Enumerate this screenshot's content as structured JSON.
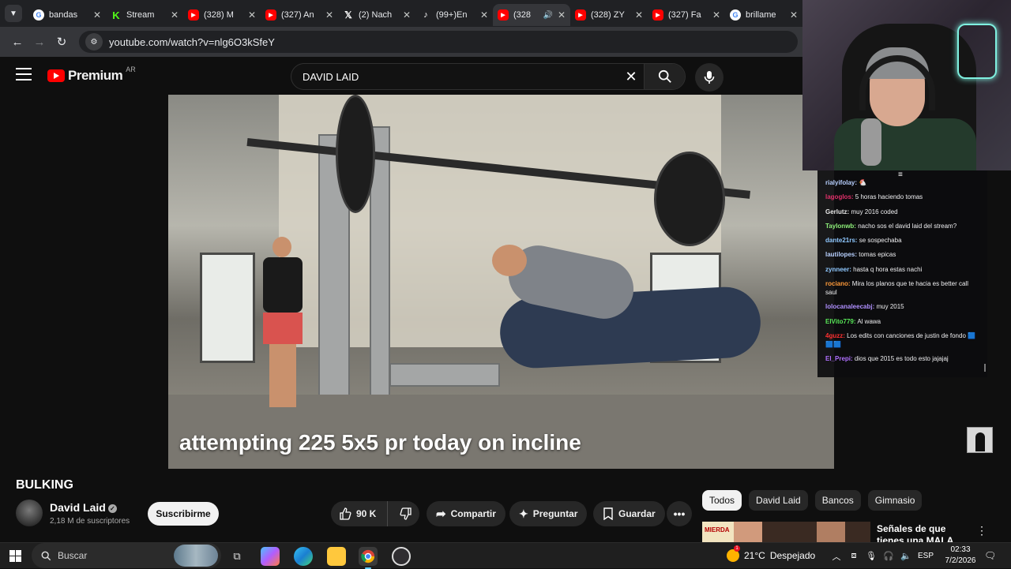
{
  "browser": {
    "tabs": [
      {
        "title": "bandas",
        "favicon": "google-icon"
      },
      {
        "title": "Stream",
        "favicon": "kick-icon"
      },
      {
        "title": "(328) M",
        "favicon": "youtube-icon"
      },
      {
        "title": "(327) An",
        "favicon": "youtube-icon"
      },
      {
        "title": "(2) Nach",
        "favicon": "x-icon"
      },
      {
        "title": "(99+)En",
        "favicon": "tiktok-icon"
      },
      {
        "title": "(328",
        "favicon": "youtube-icon",
        "active": true
      },
      {
        "title": "(328) ZY",
        "favicon": "youtube-icon"
      },
      {
        "title": "(327) Fa",
        "favicon": "youtube-icon"
      },
      {
        "title": "brillame",
        "favicon": "google-icon"
      }
    ],
    "url": "youtube.com/watch?v=nlg6O3kSfeY"
  },
  "youtube": {
    "brand": "Premium",
    "country": "AR",
    "search_query": "DAVID LAID"
  },
  "video": {
    "caption": "attempting 225 5x5 pr today on incline",
    "title": "BULKING",
    "channel": "David Laid",
    "subscribers": "2,18 M de suscriptores",
    "subscribe_label": "Suscribirme",
    "likes": "90 K",
    "share_label": "Compartir",
    "ask_label": "Preguntar",
    "save_label": "Guardar"
  },
  "chips": [
    "Todos",
    "David Laid",
    "Bancos",
    "Gimnasio"
  ],
  "recommended": {
    "badge": "MIERDA",
    "title": "Señales de que tienes una MALA GENÉTIC"
  },
  "chat": [
    {
      "user": "rialyifolay:",
      "text": "🐔",
      "color": "#b8d0ff"
    },
    {
      "user": "lagoglos:",
      "text": "5 horas haciendo tomas",
      "color": "#e0306a"
    },
    {
      "user": "Gerlutz:",
      "text": "muy 2016 coded",
      "color": "#e8e8e8"
    },
    {
      "user": "Taylonwb:",
      "text": "nacho sos el david laid del stream?",
      "color": "#8ef07a"
    },
    {
      "user": "dante21rs:",
      "text": "se sospechaba",
      "color": "#8fc8ff"
    },
    {
      "user": "lautilopes:",
      "text": "tomas epicas",
      "color": "#b8d0ff"
    },
    {
      "user": "zynneer:",
      "text": "hasta q hora estas nachi",
      "color": "#8fc8ff"
    },
    {
      "user": "rociano:",
      "text": "Mira los planos que te hacia es better call saul",
      "color": "#ff9a3a"
    },
    {
      "user": "lolocanaleecabj:",
      "text": "muy 2015",
      "color": "#b090ff"
    },
    {
      "user": "ElVito779:",
      "text": "Al wawa",
      "color": "#58e858"
    },
    {
      "user": "4guzz:",
      "text": "Los edits con canciones de justin de fondo 🟦🟦🟦",
      "color": "#ff3030"
    },
    {
      "user": "El_Prepi:",
      "text": "dios que 2015 es todo esto jajajaj",
      "color": "#b070ff"
    }
  ],
  "taskbar": {
    "search_placeholder": "Buscar",
    "temperature": "21°C",
    "weather": "Despejado",
    "weather_badge": "1",
    "language": "ESP",
    "time": "02:33",
    "date": "7/2/2026"
  },
  "colors": {
    "youtube_red": "#ff0000",
    "background": "#0f0f0f",
    "taskbar_accent": "#60cdff"
  }
}
